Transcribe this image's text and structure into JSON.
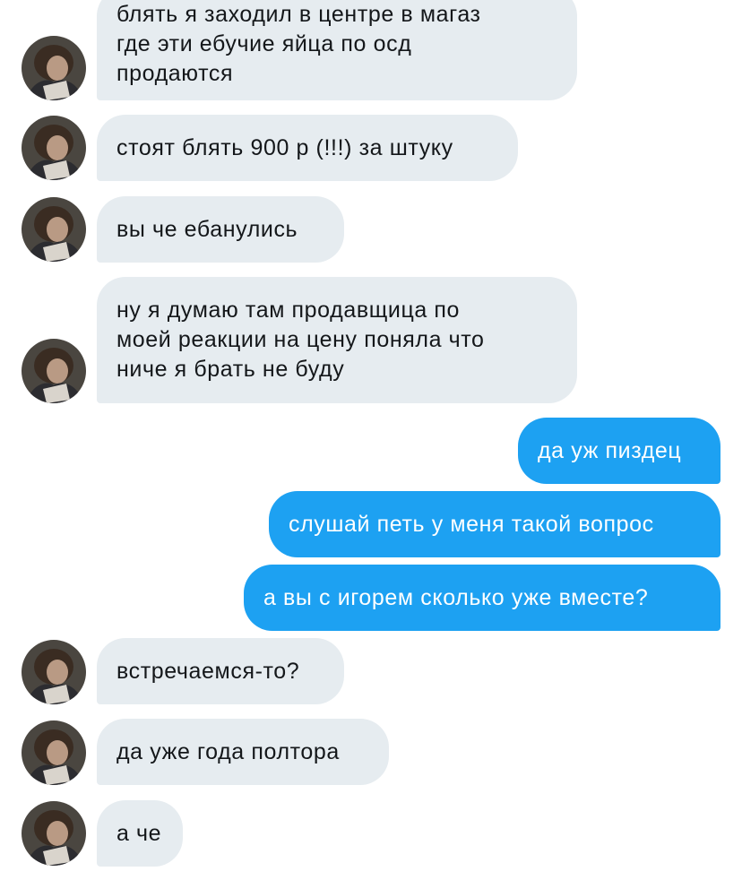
{
  "conversation": {
    "messages": [
      {
        "sender": "them",
        "text": "блять я заходил в центре в магаз\nгде эти ебучие яйца по осд\nпродаются",
        "avatar_icon": "person-photo-icon"
      },
      {
        "sender": "them",
        "text": "стоят блять 900 р (!!!) за штуку",
        "avatar_icon": "person-photo-icon"
      },
      {
        "sender": "them",
        "text": "вы че ебанулись",
        "avatar_icon": "person-photo-icon"
      },
      {
        "sender": "them",
        "text": "ну я думаю там продавщица по\nмоей реакции на цену поняла что\nниче я брать не буду",
        "avatar_icon": "person-photo-icon"
      },
      {
        "sender": "me",
        "text": "да уж пиздец"
      },
      {
        "sender": "me",
        "text": "слушай петь у меня такой вопрос"
      },
      {
        "sender": "me",
        "text": "а вы с игорем сколько уже вместе?"
      },
      {
        "sender": "them",
        "text": "встречаемся-то?",
        "avatar_icon": "person-photo-icon"
      },
      {
        "sender": "them",
        "text": "да уже года полтора",
        "avatar_icon": "person-photo-icon"
      },
      {
        "sender": "them",
        "text": "а че",
        "avatar_icon": "person-photo-icon"
      }
    ]
  },
  "colors": {
    "incoming_bubble": "#e6ecf0",
    "incoming_text": "#14171a",
    "outgoing_bubble": "#1da1f2",
    "outgoing_text": "#ffffff",
    "background": "#ffffff"
  }
}
